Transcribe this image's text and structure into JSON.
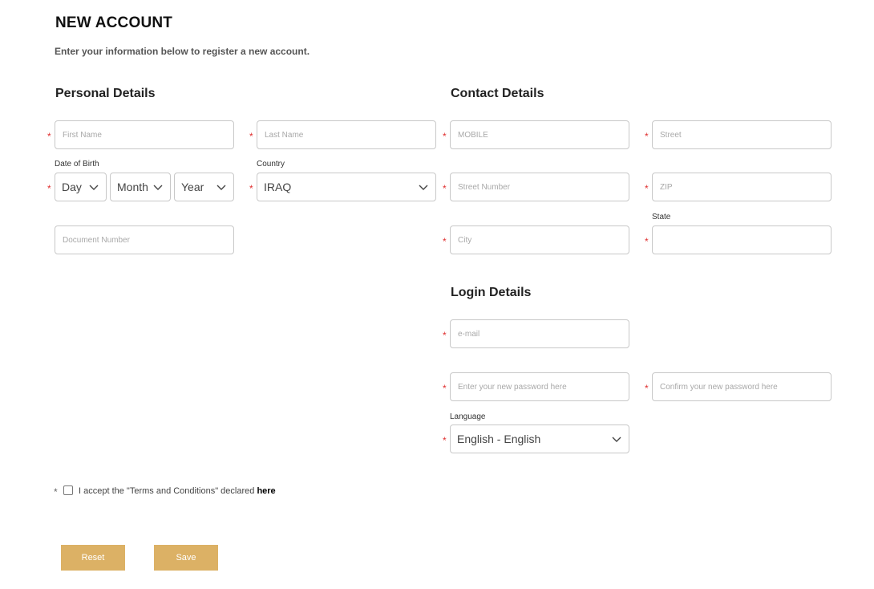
{
  "page": {
    "title": "NEW ACCOUNT",
    "subtitle": "Enter your information below to register a new account."
  },
  "personal": {
    "section_title": "Personal Details",
    "first_name_placeholder": "First Name",
    "last_name_placeholder": "Last Name",
    "dob_label": "Date of Birth",
    "day_value": "Day",
    "month_value": "Month",
    "year_value": "Year",
    "country_label": "Country",
    "country_value": "IRAQ",
    "document_placeholder": "Document Number"
  },
  "contact": {
    "section_title": "Contact Details",
    "mobile_placeholder": "MOBILE",
    "street_placeholder": "Street",
    "street_number_placeholder": "Street Number",
    "zip_placeholder": "ZIP",
    "state_label": "State",
    "city_placeholder": "City",
    "state_placeholder": ""
  },
  "login": {
    "section_title": "Login Details",
    "email_placeholder": "e-mail",
    "password_placeholder": "Enter your new password here",
    "confirm_placeholder": "Confirm your new password here",
    "language_label": "Language",
    "language_value": "English - English"
  },
  "terms": {
    "text": "I accept the \"Terms and Conditions\" declared ",
    "link": "here"
  },
  "required_marker": "*",
  "buttons": {
    "reset": "Reset",
    "save": "Save"
  },
  "colors": {
    "accent": "#dcb165",
    "required": "#e03030",
    "border": "#c8c8c8"
  }
}
